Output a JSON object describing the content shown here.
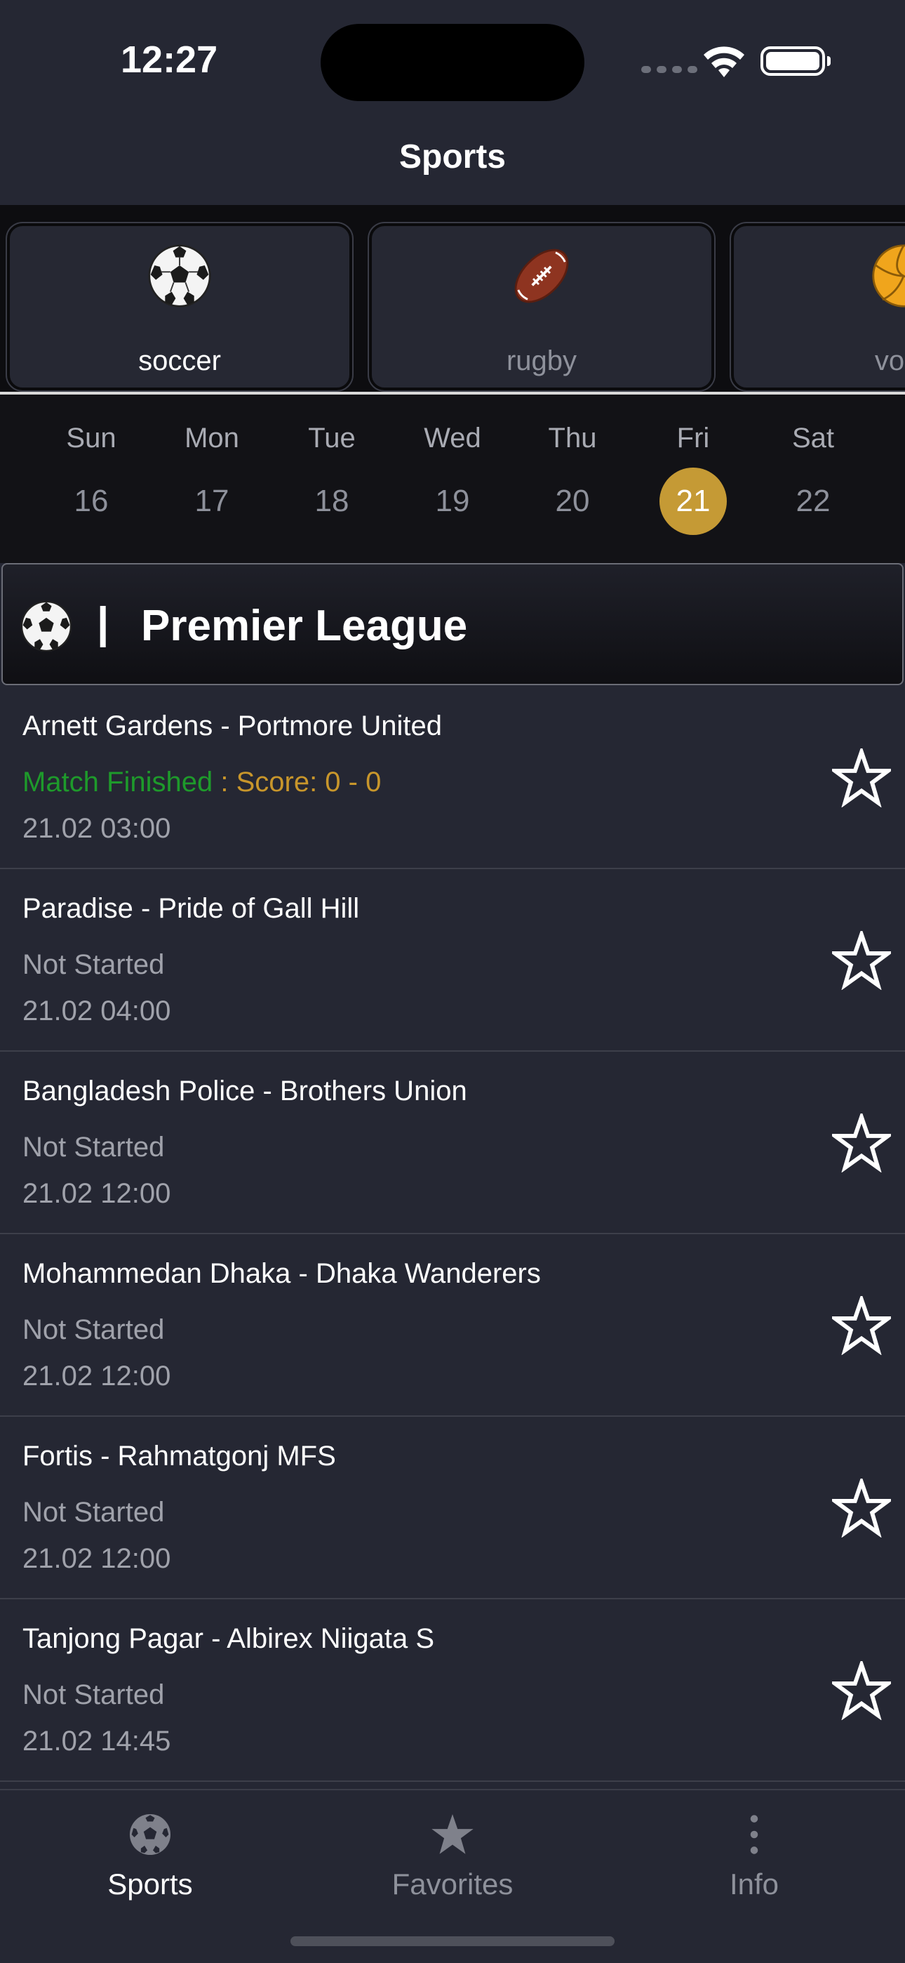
{
  "status_bar": {
    "time": "12:27"
  },
  "header": {
    "title": "Sports"
  },
  "sports": [
    {
      "label": "soccer",
      "icon": "soccer-ball-icon",
      "selected": true
    },
    {
      "label": "rugby",
      "icon": "rugby-ball-icon",
      "selected": false
    },
    {
      "label": "volle",
      "icon": "volleyball-icon",
      "selected": false
    }
  ],
  "calendar": {
    "days": [
      {
        "name": "Sun",
        "num": "16"
      },
      {
        "name": "Mon",
        "num": "17"
      },
      {
        "name": "Tue",
        "num": "18"
      },
      {
        "name": "Wed",
        "num": "19"
      },
      {
        "name": "Thu",
        "num": "20"
      },
      {
        "name": "Fri",
        "num": "21"
      },
      {
        "name": "Sat",
        "num": "22"
      }
    ],
    "selected_index": 5
  },
  "league": {
    "separator": "|",
    "name": "Premier League"
  },
  "matches": [
    {
      "title": "Arnett Gardens - Portmore United",
      "status": "Match Finished",
      "score_text": " : Score: 0 - 0",
      "time": "21.02 03:00"
    },
    {
      "title": "Paradise - Pride of Gall Hill",
      "status": "Not Started",
      "time": "21.02 04:00"
    },
    {
      "title": "Bangladesh Police - Brothers Union",
      "status": "Not Started",
      "time": "21.02 12:00"
    },
    {
      "title": "Mohammedan Dhaka - Dhaka Wanderers",
      "status": "Not Started",
      "time": "21.02 12:00"
    },
    {
      "title": "Fortis - Rahmatgonj MFS",
      "status": "Not Started",
      "time": "21.02 12:00"
    },
    {
      "title": "Tanjong Pagar - Albirex Niigata S",
      "status": "Not Started",
      "time": "21.02 14:45"
    }
  ],
  "tabs": [
    {
      "label": "Sports",
      "icon": "soccer-ball-icon",
      "active": true
    },
    {
      "label": "Favorites",
      "icon": "star-icon",
      "active": false
    },
    {
      "label": "Info",
      "icon": "more-vertical-icon",
      "active": false
    }
  ],
  "colors": {
    "background": "#252733",
    "accent": "#c59a35",
    "finished": "#1e9a2b",
    "score": "#c8962b"
  }
}
